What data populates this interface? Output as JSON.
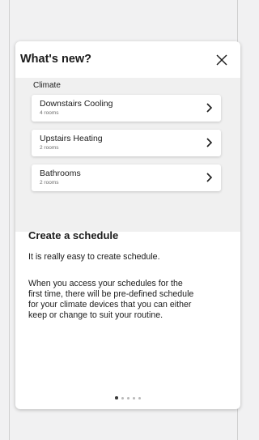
{
  "dialog": {
    "title": "What's new?",
    "close_label": "close"
  },
  "preview": {
    "section_label": "Climate",
    "rooms": [
      {
        "name": "Downstairs Cooling",
        "detail": "4 rooms"
      },
      {
        "name": "Upstairs Heating",
        "detail": "2 rooms"
      },
      {
        "name": "Bathrooms",
        "detail": "2 rooms"
      }
    ]
  },
  "content": {
    "heading": "Create a schedule",
    "intro": "It is really easy to create schedule.",
    "body_lines": [
      "When you access your schedules for the",
      "first time, there will be pre-defined schedule",
      "for your climate devices that you can either",
      "keep or change to suit your routine."
    ]
  },
  "pagination": {
    "total_pages": 5,
    "active_page": 1
  },
  "colors": {
    "background": "#f1f1f2",
    "card": "#ffffff",
    "preview_bg": "#f0f0f0",
    "text": "#1b1b1b",
    "dot_active": "#3a3a3a",
    "dot_inactive": "#b8b8b8"
  },
  "icons": {
    "close": "close-icon",
    "chevron": "chevron-right-icon"
  }
}
